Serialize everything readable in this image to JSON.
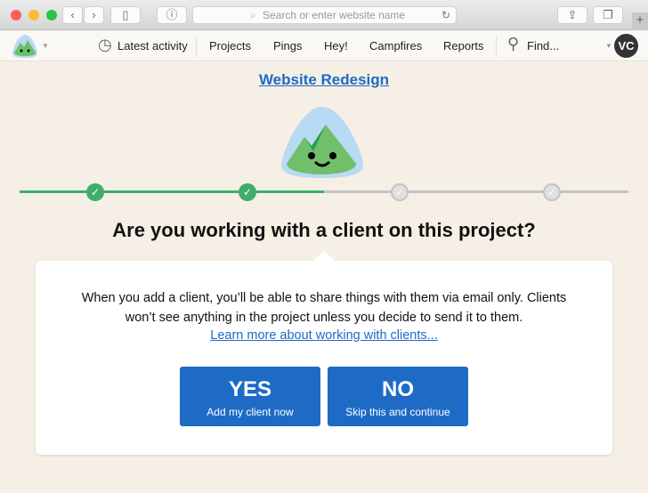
{
  "browser": {
    "url_placeholder": "Search or enter website name",
    "new_tab": "+"
  },
  "nav": {
    "items": [
      "Latest activity",
      "Projects",
      "Pings",
      "Hey!",
      "Campfires",
      "Reports"
    ],
    "find": "Find...",
    "avatar": "VC"
  },
  "page": {
    "project_title": "Website Redesign",
    "question": "Are you working with a client on this project?",
    "description_line1": "When you add a client, you’ll be able to share things with them via email only. Clients",
    "description_line2": "won’t see anything in the project unless you decide to send it to them.",
    "learn_more": "Learn more about working with clients...",
    "yes": {
      "label": "YES",
      "sub": "Add my client now"
    },
    "no": {
      "label": "NO",
      "sub": "Skip this and continue"
    }
  },
  "progress": {
    "steps_total": 4,
    "steps_complete": 2,
    "fraction": 0.5
  },
  "colors": {
    "accent": "#1e6bc6",
    "complete": "#3fae6a",
    "incomplete": "#c4c4c4",
    "background": "#f5efe6"
  }
}
